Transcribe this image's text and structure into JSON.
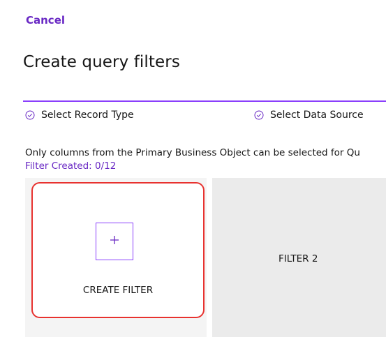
{
  "header": {
    "cancel_label": "Cancel",
    "title": "Create query filters"
  },
  "steps": [
    {
      "label": "Select Record Type",
      "icon": "check-circle-icon"
    },
    {
      "label": "Select Data Source",
      "icon": "check-circle-icon"
    }
  ],
  "info": {
    "message": "Only columns from the Primary Business Object can be selected for Qu",
    "filter_count": "Filter Created: 0/12"
  },
  "tiles": {
    "create_label": "CREATE FILTER",
    "create_icon": "plus-icon",
    "filter_2_label": "FILTER 2"
  },
  "colors": {
    "accent": "#6929c4",
    "progress": "#8a3ffc",
    "highlight": "#e8322f"
  }
}
